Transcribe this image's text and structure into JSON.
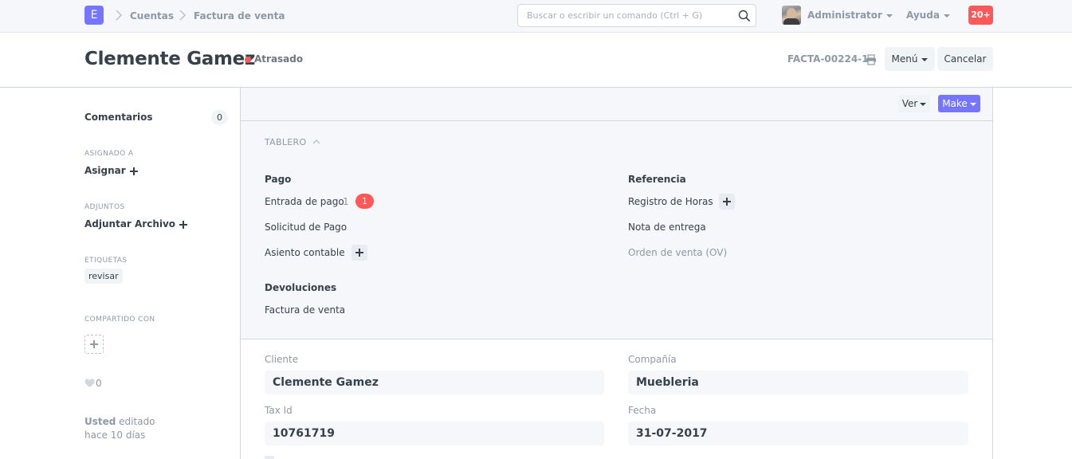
{
  "navbar": {
    "logo_letter": "E",
    "breadcrumbs": [
      "Cuentas",
      "Factura de venta"
    ],
    "search_placeholder": "Buscar o escribir un comando (Ctrl + G)",
    "user_label": "Administrator",
    "help_label": "Ayuda",
    "notifications": "20+"
  },
  "page_head": {
    "title": "Clemente Gamez",
    "status": "Atrasado",
    "doc_id": "FACTA-00224-1",
    "menu_label": "Menú",
    "cancel_label": "Cancelar"
  },
  "sidebar": {
    "comments_label": "Comentarios",
    "comments_count": "0",
    "assigned_caption": "ASIGNADO A",
    "assign_label": "Asignar",
    "attachments_caption": "ADJUNTOS",
    "attach_label": "Adjuntar Archivo",
    "tags_caption": "ETIQUETAS",
    "tag": "revisar",
    "shared_caption": "COMPARTIDO CON",
    "likes": "0",
    "modified_by": "Usted",
    "modified_action": " editado",
    "modified_when": "hace 10 días"
  },
  "toolbar": {
    "view_label": "Ver",
    "make_label": "Make"
  },
  "dashboard": {
    "caption": "TABLERO",
    "groups": {
      "pago": {
        "title": "Pago",
        "items": [
          "Entrada de pago",
          "Solicitud de Pago",
          "Asiento contable"
        ],
        "entrada_count": "1",
        "entrada_badge": "1"
      },
      "referencia": {
        "title": "Referencia",
        "items": [
          "Registro de Horas",
          "Nota de entrega",
          "Orden de venta (OV)"
        ]
      },
      "devoluciones": {
        "title": "Devoluciones",
        "items": [
          "Factura de venta"
        ]
      }
    }
  },
  "form": {
    "customer_label": "Cliente",
    "customer_value": "Clemente Gamez",
    "company_label": "Compañía",
    "company_value": "Muebleria",
    "tax_label": "Tax Id",
    "tax_value": "10761719",
    "date_label": "Fecha",
    "date_value": "31-07-2017"
  },
  "colors": {
    "accent": "#7575ff",
    "danger": "#ff5858",
    "text": "#36414c",
    "muted": "#8d99a6",
    "panel": "#f5f7fa"
  }
}
